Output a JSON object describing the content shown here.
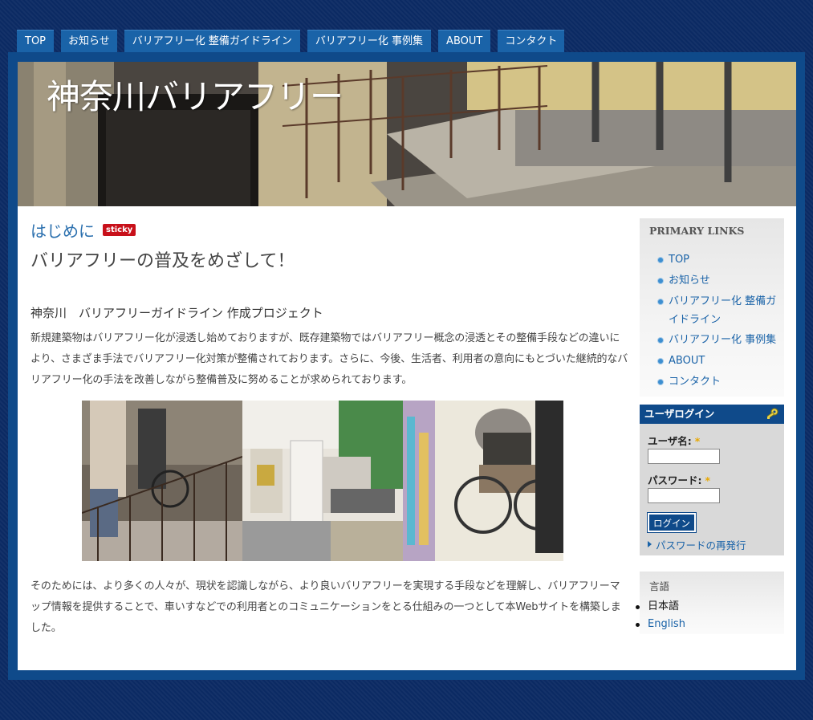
{
  "nav": {
    "items": [
      "TOP",
      "お知らせ",
      "バリアフリー化 整備ガイドライン",
      "バリアフリー化 事例集",
      "ABOUT",
      "コンタクト"
    ]
  },
  "header": {
    "site_title": "神奈川バリアフリー"
  },
  "post": {
    "title": "はじめに",
    "sticky_badge": "sticky",
    "subtitle": "バリアフリーの普及をめざして！",
    "section_heading": "神奈川　バリアフリーガイドライン 作成プロジェクト",
    "paragraph1": "新規建築物はバリアフリー化が浸透し始めておりますが、既存建築物ではバリアフリー概念の浸透とその整備手段などの違いにより、さまざま手法でバリアフリー化対策が整備されております。さらに、今後、生活者、利用者の意向にもとづいた継続的なバリアフリー化の手法を改善しながら整備普及に努めることが求められております。",
    "paragraph2": "そのためには、より多くの人々が、現状を認識しながら、より良いバリアフリーを実現する手段などを理解し、バリアフリーマップ情報を提供することで、車いすなどでの利用者とのコミュニケーションをとる仕組みの一つとして本Webサイトを構築しました。"
  },
  "sidebar": {
    "primary_links": {
      "title": "PRIMARY LINKS",
      "items": [
        "TOP",
        "お知らせ",
        "バリアフリー化 整備ガイドライン",
        "バリアフリー化 事例集",
        "ABOUT",
        "コンタクト"
      ]
    },
    "login": {
      "title": "ユーザログイン",
      "username_label": "ユーザ名:",
      "password_label": "パスワード:",
      "required_mark": "*",
      "username_value": "",
      "password_value": "",
      "submit_label": "ログイン",
      "reset_link": "パスワードの再発行"
    },
    "language": {
      "title": "言語",
      "items": [
        "日本語",
        "English"
      ]
    }
  },
  "colors": {
    "nav_bg": "#1a63a8",
    "frame": "#0f4a8a",
    "link": "#1a63a8",
    "sticky": "#c8101a"
  }
}
